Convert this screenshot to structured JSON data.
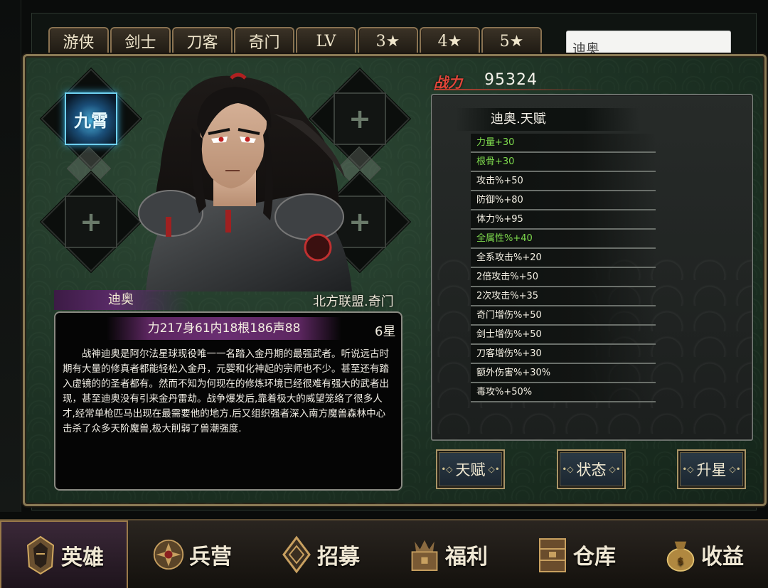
{
  "tabs": [
    "游侠",
    "剑士",
    "刀客",
    "奇门",
    "LV",
    "3★",
    "4★",
    "5★"
  ],
  "search": {
    "value": "迪奥"
  },
  "power": {
    "label": "战力",
    "value": "95324"
  },
  "skill_slot": {
    "label": "九霄"
  },
  "hero": {
    "name": "迪奥",
    "faction": "北方联盟.奇门",
    "stats": "力217身61内18根186声88",
    "stars": "6星",
    "bio": "战神迪奥是阿尔法星球现役唯一一名踏入金丹期的最强武者。听说远古时期有大量的修真者都能轻松入金丹，元婴和化神起的宗师也不少。甚至还有踏入虚镜的的圣者都有。然而不知为何现在的修炼环境已经很难有强大的武者出现，甚至迪奥没有引来金丹雷劫。战争爆发后,靠着极大的威望笼络了很多人才,经常单枪匹马出现在最需要他的地方.后又组织强者深入南方魔兽森林中心击杀了众多天阶魔兽,极大削弱了兽潮强度."
  },
  "talent": {
    "title": "迪奥.天赋",
    "items": [
      {
        "text": "力量+30",
        "color": "green"
      },
      {
        "text": "根骨+30",
        "color": "green"
      },
      {
        "text": "攻击%+50",
        "color": "white"
      },
      {
        "text": "防御%+80",
        "color": "white"
      },
      {
        "text": "体力%+95",
        "color": "white"
      },
      {
        "text": "全属性%+40",
        "color": "green"
      },
      {
        "text": "全系攻击%+20",
        "color": "white"
      },
      {
        "text": "2倍攻击%+50",
        "color": "white"
      },
      {
        "text": "2次攻击%+35",
        "color": "white"
      },
      {
        "text": "奇门增伤%+50",
        "color": "white"
      },
      {
        "text": "剑士增伤%+50",
        "color": "white"
      },
      {
        "text": "刀客增伤%+30",
        "color": "white"
      },
      {
        "text": "额外伤害%+30%",
        "color": "white"
      },
      {
        "text": "毒攻%+50%",
        "color": "white"
      }
    ]
  },
  "buttons": {
    "talent": "天赋",
    "status": "状态",
    "star_up": "升星",
    "dots": "•◇"
  },
  "nav": [
    "英雄",
    "兵营",
    "招募",
    "福利",
    "仓库",
    "收益"
  ],
  "colors": {
    "talent_green": "#7fdc4e",
    "power_red": "#e4463a",
    "frame_gold": "#8a7a55"
  }
}
